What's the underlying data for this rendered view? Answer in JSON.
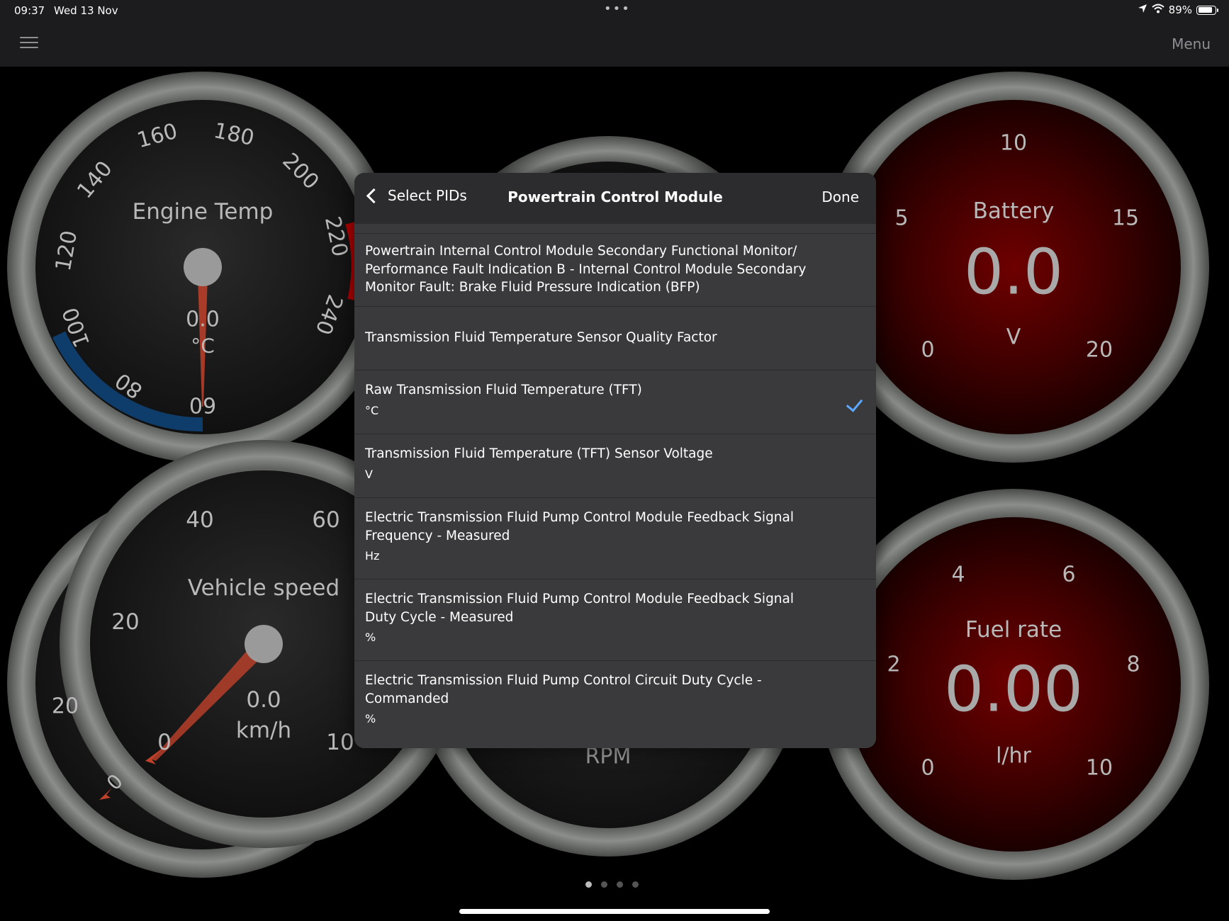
{
  "status_bar": {
    "time": "09:37",
    "date": "Wed 13 Nov",
    "battery_percent": "89%",
    "battery_level": 0.89
  },
  "nav": {
    "menu_label": "Menu"
  },
  "gauges": {
    "engine_temp": {
      "title": "Engine Temp",
      "value": "0.0",
      "unit": "°C",
      "ticks": [
        "60",
        "80",
        "100",
        "120",
        "140",
        "160",
        "180",
        "200",
        "220",
        "240"
      ]
    },
    "battery": {
      "title": "Battery",
      "value": "0.0",
      "unit": "V",
      "ticks": [
        "0",
        "5",
        "10",
        "15",
        "20"
      ]
    },
    "vehicle_speed": {
      "title": "Vehicle speed",
      "value": "0.0",
      "unit": "km/h",
      "ticks": [
        "0",
        "20",
        "40",
        "60",
        "10"
      ]
    },
    "rpm": {
      "unit": "RPM"
    },
    "back_left": {
      "ticks": [
        "20",
        "0"
      ]
    },
    "fuel_rate": {
      "title": "Fuel rate",
      "value": "0.00",
      "unit": "l/hr",
      "ticks": [
        "0",
        "2",
        "4",
        "6",
        "8",
        "10"
      ]
    }
  },
  "modal": {
    "back_label": "Select PIDs",
    "title": "Powertrain Control Module",
    "done_label": "Done",
    "items": [
      {
        "title": "Powertrain Internal Control Module Secondary Functional Monitor/ Performance Fault Indication B - Internal Control Module Secondary Monitor Fault: Brake Fluid Pressure Indication (BFP)",
        "unit": "",
        "selected": false
      },
      {
        "title": "Transmission Fluid Temperature Sensor Quality Factor",
        "unit": "",
        "selected": false
      },
      {
        "title": "Raw Transmission Fluid Temperature (TFT)",
        "unit": "°C",
        "selected": true
      },
      {
        "title": "Transmission Fluid Temperature (TFT) Sensor Voltage",
        "unit": "V",
        "selected": false
      },
      {
        "title": "Electric Transmission Fluid Pump Control Module Feedback Signal Frequency - Measured",
        "unit": "Hz",
        "selected": false
      },
      {
        "title": "Electric Transmission Fluid Pump Control Module Feedback Signal Duty Cycle - Measured",
        "unit": "%",
        "selected": false
      },
      {
        "title": "Electric Transmission Fluid Pump Control Circuit Duty Cycle - Commanded",
        "unit": "%",
        "selected": false
      }
    ]
  },
  "pagination": {
    "pages": 4,
    "active_page": 1
  },
  "colors": {
    "accent_check": "#5aa9ff",
    "cold_arc": "#0f3d6b",
    "hot_arc": "#b50000",
    "needle": "#c0412a"
  }
}
